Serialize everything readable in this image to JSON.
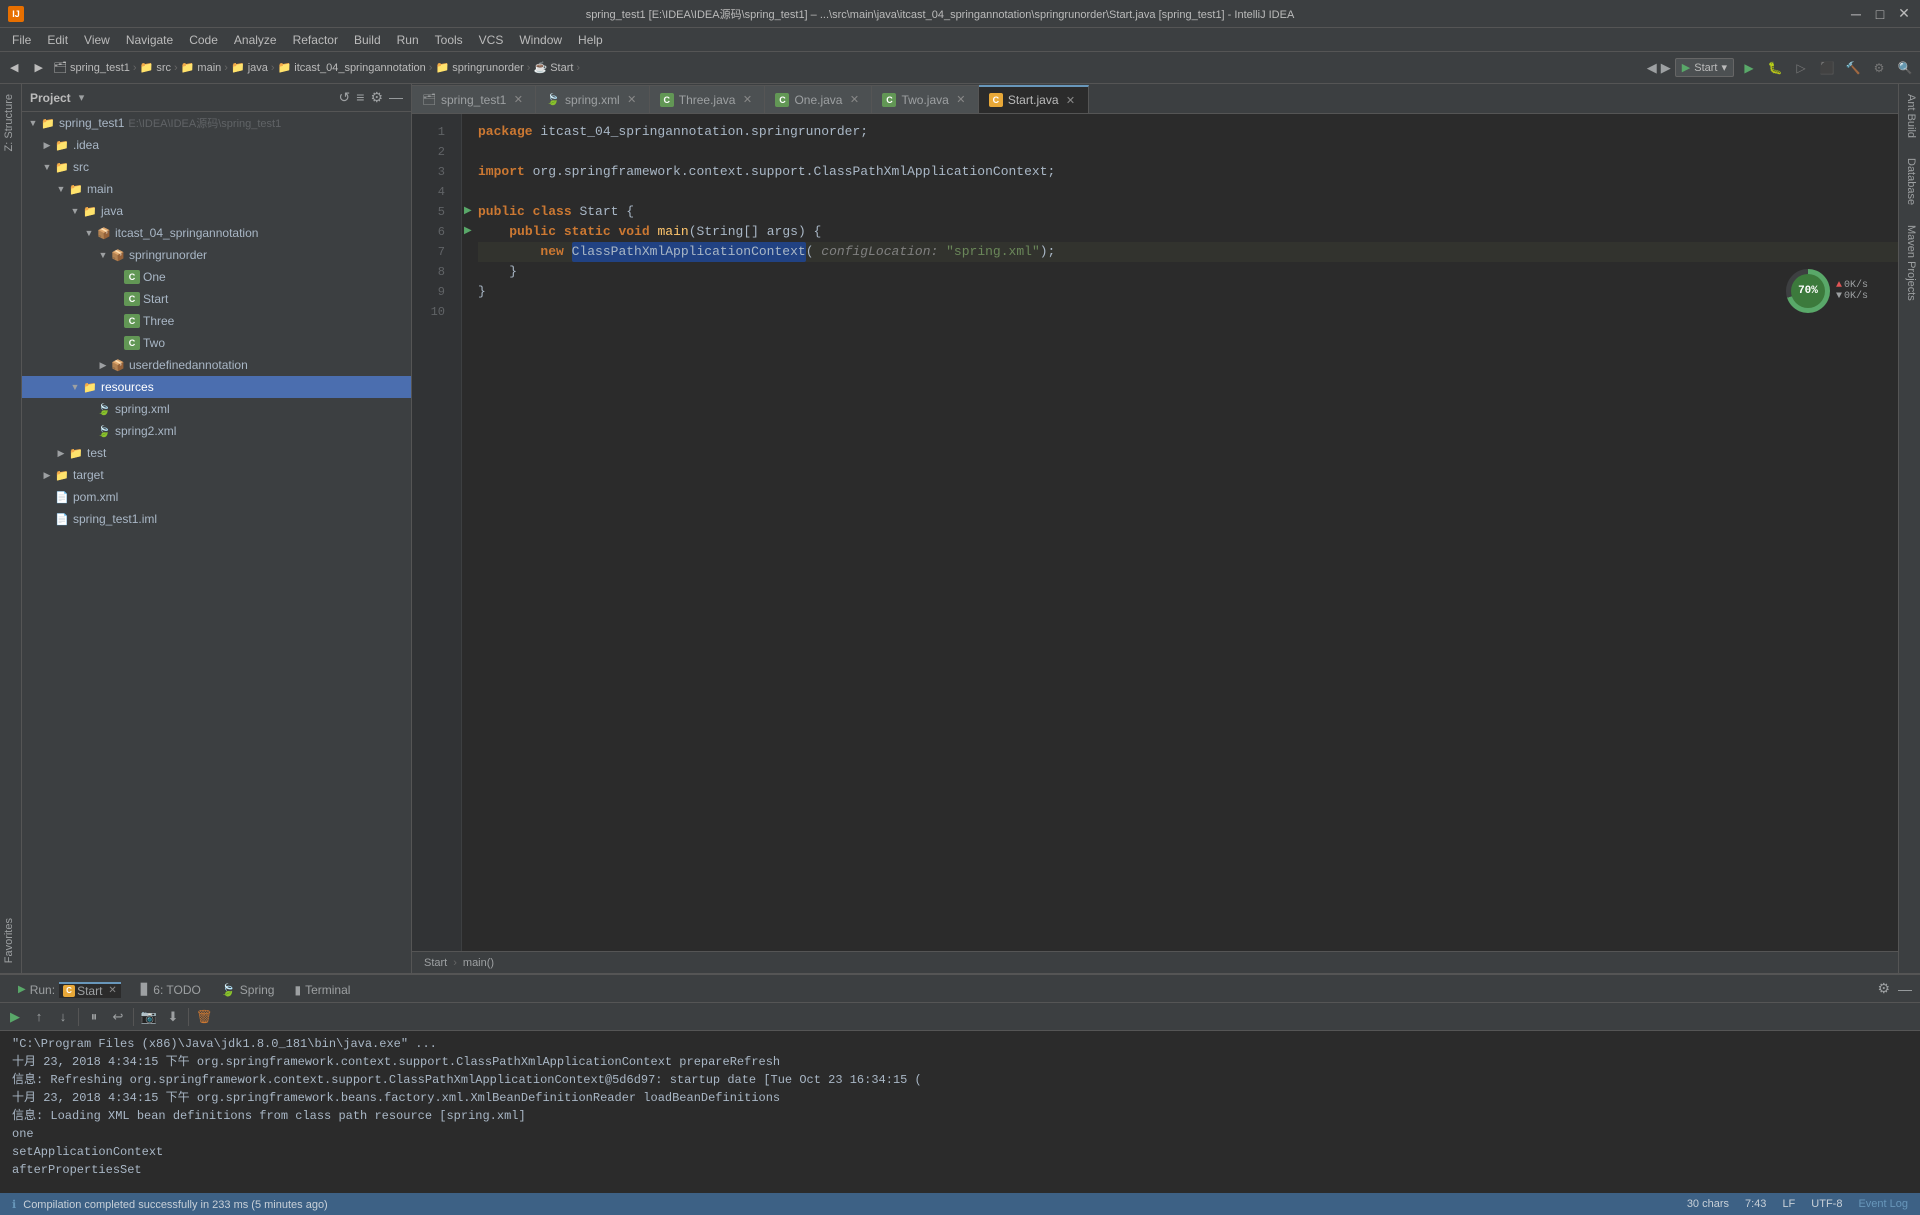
{
  "titlebar": {
    "title": "spring_test1 [E:\\IDEA\\IDEA源码\\spring_test1] – ...\\src\\main\\java\\itcast_04_springannotation\\springrunorder\\Start.java [spring_test1] - IntelliJ IDEA",
    "app_icon": "IJ"
  },
  "menubar": {
    "items": [
      "File",
      "Edit",
      "View",
      "Navigate",
      "Code",
      "Analyze",
      "Refactor",
      "Build",
      "Run",
      "Tools",
      "VCS",
      "Window",
      "Help"
    ]
  },
  "toolbar": {
    "breadcrumbs": [
      "spring_test1",
      "src",
      "main",
      "java",
      "itcast_04_springannotation",
      "springrunorder",
      "Start"
    ],
    "run_config": "Start",
    "run_label": "Start"
  },
  "project_panel": {
    "title": "Project",
    "root": "spring_test1",
    "root_path": "E:\\IDEA\\IDEA源码\\spring_test1",
    "tree": [
      {
        "label": ".idea",
        "type": "folder",
        "indent": 1,
        "expanded": false
      },
      {
        "label": "src",
        "type": "folder",
        "indent": 1,
        "expanded": true
      },
      {
        "label": "main",
        "type": "folder",
        "indent": 2,
        "expanded": true
      },
      {
        "label": "java",
        "type": "folder",
        "indent": 3,
        "expanded": true
      },
      {
        "label": "itcast_04_springannotation",
        "type": "folder",
        "indent": 4,
        "expanded": true
      },
      {
        "label": "springrunorder",
        "type": "folder",
        "indent": 5,
        "expanded": true
      },
      {
        "label": "One",
        "type": "class",
        "indent": 6
      },
      {
        "label": "Start",
        "type": "class",
        "indent": 6
      },
      {
        "label": "Three",
        "type": "class",
        "indent": 6
      },
      {
        "label": "Two",
        "type": "class",
        "indent": 6
      },
      {
        "label": "userdefinedannotation",
        "type": "folder",
        "indent": 5,
        "expanded": false
      },
      {
        "label": "resources",
        "type": "folder",
        "indent": 3,
        "expanded": true,
        "selected": true
      },
      {
        "label": "spring.xml",
        "type": "xml",
        "indent": 4
      },
      {
        "label": "spring2.xml",
        "type": "xml",
        "indent": 4
      },
      {
        "label": "test",
        "type": "folder",
        "indent": 2,
        "expanded": false
      },
      {
        "label": "target",
        "type": "folder",
        "indent": 1,
        "expanded": false
      },
      {
        "label": "pom.xml",
        "type": "pom",
        "indent": 1
      }
    ]
  },
  "tabs": [
    {
      "label": "spring_test1",
      "type": "project",
      "active": false
    },
    {
      "label": "spring.xml",
      "type": "xml",
      "active": false
    },
    {
      "label": "Three.java",
      "type": "class",
      "active": false
    },
    {
      "label": "One.java",
      "type": "class",
      "active": false
    },
    {
      "label": "Two.java",
      "type": "class",
      "active": false
    },
    {
      "label": "Start.java",
      "type": "class",
      "active": true
    }
  ],
  "code": {
    "lines": [
      {
        "num": 1,
        "content": "package itcast_04_springannotation.springrunorder;",
        "type": "package"
      },
      {
        "num": 2,
        "content": "",
        "type": "blank"
      },
      {
        "num": 3,
        "content": "import org.springframework.context.support.ClassPathXmlApplicationContext;",
        "type": "import"
      },
      {
        "num": 4,
        "content": "",
        "type": "blank"
      },
      {
        "num": 5,
        "content": "public class Start {",
        "type": "class",
        "has_arrow": true
      },
      {
        "num": 6,
        "content": "    public static void main(String[] args) {",
        "type": "method",
        "has_arrow": true
      },
      {
        "num": 7,
        "content": "        new ClassPathXmlApplicationContext( configLocation: \"spring.xml\");",
        "type": "code",
        "highlighted": true
      },
      {
        "num": 8,
        "content": "    }",
        "type": "code"
      },
      {
        "num": 9,
        "content": "}",
        "type": "code"
      },
      {
        "num": 10,
        "content": "",
        "type": "blank"
      }
    ]
  },
  "status_breadcrumb": {
    "items": [
      "Start",
      "main()"
    ]
  },
  "perf": {
    "percent": "70%",
    "up_speed": "0K/s",
    "down_speed": "0K/s"
  },
  "bottom_panel": {
    "run_tab": "Start",
    "tabs": [
      {
        "label": "4: Run",
        "icon": "▶",
        "active": false
      },
      {
        "label": "6: TODO",
        "active": false
      },
      {
        "label": "Spring",
        "active": false
      },
      {
        "label": "Terminal",
        "active": false
      }
    ],
    "console_lines": [
      "\"C:\\Program Files (x86)\\Java\\jdk1.8.0_181\\bin\\java.exe\" ...",
      "十月 23, 2018 4:34:15 下午 org.springframework.context.support.ClassPathXmlApplicationContext prepareRefresh",
      "信息: Refreshing org.springframework.context.support.ClassPathXmlApplicationContext@5d6d97: startup date [Tue Oct 23 16:34:15 (",
      "十月 23, 2018 4:34:15 下午 org.springframework.beans.factory.xml.XmlBeanDefinitionReader loadBeanDefinitions",
      "信息: Loading XML bean definitions from class path resource [spring.xml]",
      "one",
      "setApplicationContext",
      "afterPropertiesSet"
    ]
  },
  "statusbar": {
    "message": "Compilation completed successfully in 233 ms (5 minutes ago)",
    "chars": "30 chars",
    "position": "7:43",
    "line_sep": "LF",
    "encoding": "UTF-8",
    "event_log": "Event Log"
  },
  "side_panels": {
    "left": [
      "Z: Structure",
      "Favorites"
    ],
    "right": [
      "Ant Build",
      "Database",
      "Maven Projects"
    ]
  }
}
